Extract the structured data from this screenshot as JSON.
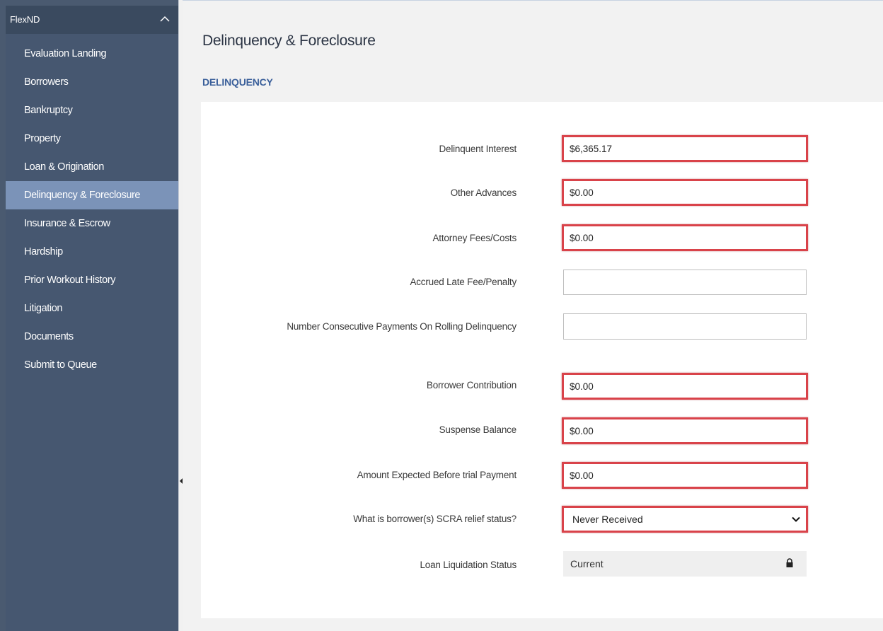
{
  "sidebar": {
    "header": "FlexND",
    "items": [
      {
        "label": "Evaluation Landing"
      },
      {
        "label": "Borrowers"
      },
      {
        "label": "Bankruptcy"
      },
      {
        "label": "Property"
      },
      {
        "label": "Loan & Origination"
      },
      {
        "label": "Delinquency & Foreclosure",
        "active": true
      },
      {
        "label": "Insurance & Escrow"
      },
      {
        "label": "Hardship"
      },
      {
        "label": "Prior Workout History"
      },
      {
        "label": "Litigation"
      },
      {
        "label": "Documents"
      },
      {
        "label": "Submit to Queue"
      }
    ]
  },
  "main": {
    "page_title": "Delinquency & Foreclosure",
    "section_title": "DELINQUENCY",
    "fields": {
      "delinquent_interest": {
        "label": "Delinquent Interest",
        "value": "$6,365.17"
      },
      "other_advances": {
        "label": "Other Advances",
        "value": "$0.00"
      },
      "attorney_fees": {
        "label": "Attorney Fees/Costs",
        "value": "$0.00"
      },
      "accrued_late_fee": {
        "label": "Accrued Late Fee/Penalty",
        "value": ""
      },
      "consecutive_payments": {
        "label": "Number Consecutive Payments On Rolling Delinquency",
        "value": ""
      },
      "borrower_contribution": {
        "label": "Borrower Contribution",
        "value": "$0.00"
      },
      "suspense_balance": {
        "label": "Suspense Balance",
        "value": "$0.00"
      },
      "amount_expected": {
        "label": "Amount Expected Before trial Payment",
        "value": "$0.00"
      },
      "scra_status": {
        "label": "What is borrower(s) SCRA relief status?",
        "value": "Never Received"
      },
      "loan_liquidation": {
        "label": "Loan Liquidation Status",
        "value": "Current"
      }
    }
  },
  "colors": {
    "sidebar_bg": "#465770",
    "sidebar_active": "#7b93b8",
    "section_title": "#3a5f9a",
    "highlight_border": "#d9434a"
  },
  "icons": {
    "collapse": "chevron-up-icon",
    "dropdown": "chevron-down-icon",
    "locked": "lock-icon"
  }
}
